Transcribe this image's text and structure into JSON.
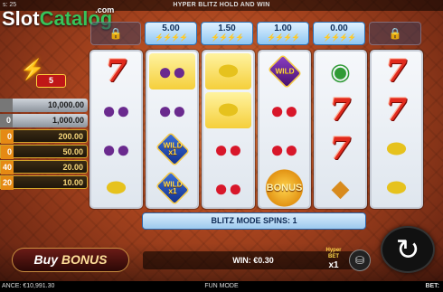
{
  "topbar": {
    "left": "s: 25",
    "title": "HYPER BLITZ HOLD AND WIN"
  },
  "logo": {
    "slot": "Slot",
    "catalog": "Catalog",
    "com": ".com"
  },
  "tiles": [
    {
      "type": "lock"
    },
    {
      "type": "value",
      "value": "5.00"
    },
    {
      "type": "value",
      "value": "1.50"
    },
    {
      "type": "value",
      "value": "1.00"
    },
    {
      "type": "value",
      "value": "0.00"
    },
    {
      "type": "lock"
    }
  ],
  "reels": [
    [
      "seven",
      "plum",
      "plum",
      "lemon"
    ],
    [
      "plum-hl",
      "plum",
      "wild-x1",
      "wild-x1"
    ],
    [
      "lemon-hl",
      "lemon-hl",
      "cherry",
      "cherry"
    ],
    [
      "wild-purple",
      "cherry",
      "cherry",
      "bonus"
    ],
    [
      "melon",
      "seven",
      "seven",
      "pineapple"
    ],
    [
      "seven",
      "seven",
      "lemon",
      "lemon"
    ]
  ],
  "symbols": {
    "wild": "WILD",
    "wild_x1": "WILD x1",
    "bonus": "BONUS"
  },
  "bolt_counter": {
    "icon": "lightning-icon",
    "value": "5"
  },
  "prizes": [
    {
      "level": "",
      "amount": "10,000.00",
      "style": "grey"
    },
    {
      "level": "0",
      "amount": "1,000.00",
      "style": "grey"
    },
    {
      "level": "0",
      "amount": "200.00",
      "style": "gold"
    },
    {
      "level": "0",
      "amount": "50.00",
      "style": "gold"
    },
    {
      "level": "40",
      "amount": "20.00",
      "style": "gold"
    },
    {
      "level": "20",
      "amount": "10.00",
      "style": "gold"
    }
  ],
  "blitz_mode": {
    "label": "BLITZ MODE SPINS:",
    "count": "1"
  },
  "buy_bonus": {
    "label_1": "Buy",
    "label_2": "BONUS"
  },
  "win": {
    "label": "WIN:",
    "value": "€0.30"
  },
  "hyper_bet": {
    "label": "Hyper BET",
    "multiplier": "x1"
  },
  "status": {
    "balance_label": "ANCE:",
    "balance": "€10,991.30",
    "mode": "FUN MODE",
    "bet_label": "BET:"
  }
}
